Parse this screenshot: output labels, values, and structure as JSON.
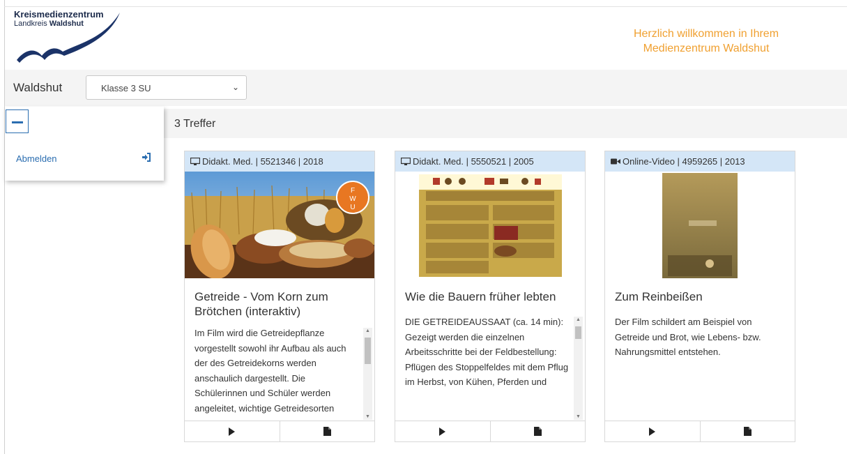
{
  "header": {
    "logo_line1": "Kreismedienzentrum",
    "logo_line2_prefix": "Landkreis ",
    "logo_line2_bold": "Waldshut",
    "welcome_line1": "Herzlich willkommen in Ihrem",
    "welcome_line2": "Medienzentrum Waldshut",
    "welcome_color": "#f0a030"
  },
  "toolbar": {
    "location_label": "Waldshut",
    "class_select_value": "Klasse 3 SU"
  },
  "sidepanel": {
    "collapse_icon": "minus-icon",
    "logout_label": "Abmelden",
    "logout_icon": "sign-in-icon"
  },
  "results": {
    "count_label": "3 Treffer"
  },
  "cards": [
    {
      "header_icon": "monitor-icon",
      "header": "Didakt. Med. | 5521346 | 2018",
      "title": "Getreide - Vom Korn zum Brötchen (interaktiv)",
      "description": "Im Film wird die Getreidepflanze vorgestellt sowohl ihr Aufbau als auch der des Getreidekorns werden anschaulich dargestellt. Die Schülerinnen und Schüler werden angeleitet, wichtige Getreidesorten",
      "badge": "F\nW\nU",
      "play_icon": "play-icon",
      "doc_icon": "document-icon"
    },
    {
      "header_icon": "monitor-icon",
      "header": "Didakt. Med. | 5550521 | 2005",
      "title": "Wie die Bauern früher lebten",
      "description": "DIE GETREIDEAUSSAAT (ca. 14 min):\nGezeigt werden die einzelnen Arbeitsschritte bei der Feldbestellung: Pflügen des Stoppelfeldes mit dem Pflug im Herbst, von Kühen, Pferden und",
      "play_icon": "play-icon",
      "doc_icon": "document-icon"
    },
    {
      "header_icon": "video-camera-icon",
      "header": "Online-Video | 4959265 | 2013",
      "title": "Zum Reinbeißen",
      "description": "Der Film schildert am Beispiel von Getreide und Brot, wie Lebens- bzw. Nahrungsmittel entstehen.",
      "play_icon": "play-icon",
      "doc_icon": "document-icon"
    }
  ],
  "colors": {
    "accent_blue": "#2a6db0",
    "card_header_bg": "#d4e6f7"
  }
}
